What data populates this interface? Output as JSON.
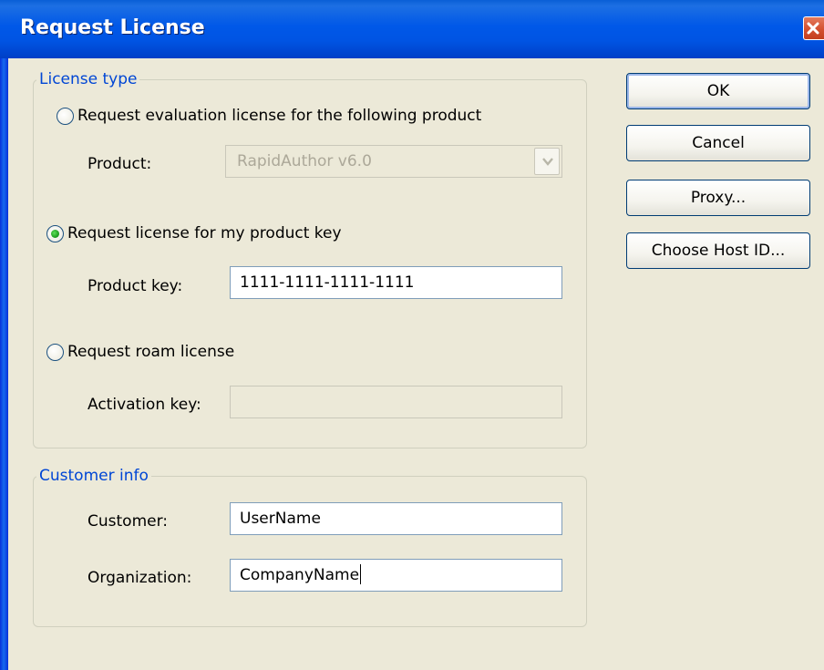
{
  "window": {
    "title": "Request License"
  },
  "license_type": {
    "legend": "License type",
    "eval": {
      "label": "Request evaluation license for the following product",
      "checked": false
    },
    "product": {
      "label": "Product:",
      "value": "RapidAuthor v6.0"
    },
    "key": {
      "label": "Request license for my product key",
      "checked": true
    },
    "product_key": {
      "label": "Product key:",
      "value": "1111-1111-1111-1111"
    },
    "roam": {
      "label": "Request roam license",
      "checked": false
    },
    "activation_key": {
      "label": "Activation key:",
      "value": ""
    }
  },
  "customer_info": {
    "legend": "Customer info",
    "customer": {
      "label": "Customer:",
      "value": "UserName"
    },
    "organization": {
      "label": "Organization:",
      "value": "CompanyName"
    }
  },
  "buttons": {
    "ok": "OK",
    "cancel": "Cancel",
    "proxy": "Proxy...",
    "host_id": "Choose Host ID..."
  },
  "icons": {
    "close": "close-icon",
    "dropdown": "chevron-down-icon"
  },
  "colors": {
    "titlebar": "#0054e3",
    "legend": "#0046d5",
    "dialog_bg": "#ece9d8",
    "close": "#d4502f"
  }
}
